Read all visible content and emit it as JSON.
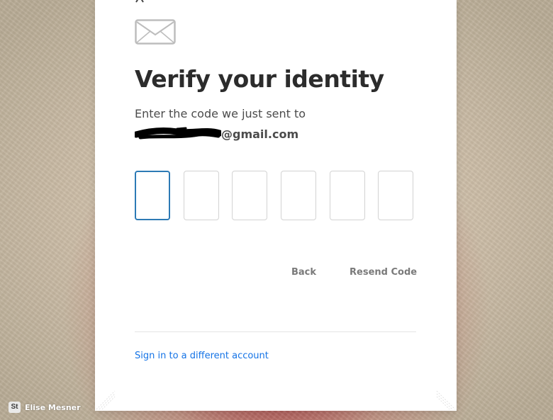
{
  "verify": {
    "title": "Verify your identity",
    "sent_label": "Enter the code we just sent to",
    "email_domain": "@gmail.com"
  },
  "code": {
    "digits": [
      "",
      "",
      "",
      "",
      "",
      ""
    ],
    "active_index": 0
  },
  "actions": {
    "back_label": "Back",
    "resend_label": "Resend Code"
  },
  "links": {
    "different_account": "Sign in to a different account"
  },
  "footer": {
    "badge": "St",
    "author": "Elise Mesner"
  },
  "colors": {
    "accent": "#1473e6",
    "active_border": "#2d7ab5",
    "title": "#2c2c2c"
  },
  "icons": {
    "mail": "envelope-icon",
    "badge": "stock-badge-icon"
  }
}
